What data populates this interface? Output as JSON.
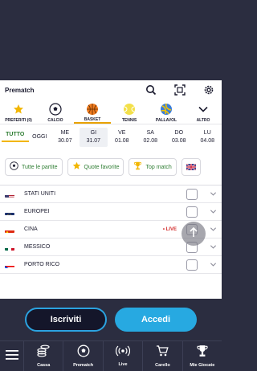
{
  "header": {
    "title": "Prematch"
  },
  "sports": [
    {
      "label": "PREFERITI (0)",
      "icon": "star-icon"
    },
    {
      "label": "CALCIO",
      "icon": "soccer-ball-icon"
    },
    {
      "label": "BASKET",
      "icon": "basketball-icon"
    },
    {
      "label": "TENNIS",
      "icon": "tennis-ball-icon"
    },
    {
      "label": "PALLAVOL",
      "icon": "volleyball-icon"
    },
    {
      "label": "ALTRO",
      "icon": "chevron-down-icon"
    }
  ],
  "dates": {
    "tutto": "TUTTO",
    "oggi": "OGGI",
    "days": [
      {
        "wd": "ME",
        "dt": "30.07"
      },
      {
        "wd": "GI",
        "dt": "31.07"
      },
      {
        "wd": "VE",
        "dt": "01.08"
      },
      {
        "wd": "SA",
        "dt": "02.08"
      },
      {
        "wd": "DO",
        "dt": "03.08"
      },
      {
        "wd": "LU",
        "dt": "04.08"
      }
    ]
  },
  "filters": [
    {
      "label": "Tutte le partite",
      "icon": "soccer-ball-icon"
    },
    {
      "label": "Quote favorite",
      "icon": "star-icon"
    },
    {
      "label": "Top match",
      "icon": "trophy-icon"
    }
  ],
  "countries": [
    {
      "name": "STATI UNITI",
      "live": ""
    },
    {
      "name": "EUROPEI",
      "live": ""
    },
    {
      "name": "CINA",
      "live": "• LIVE"
    },
    {
      "name": "MESSICO",
      "live": ""
    },
    {
      "name": "PORTO RICO",
      "live": ""
    }
  ],
  "cta": {
    "register": "Iscriviti",
    "login": "Accedi"
  },
  "nav": [
    {
      "label": "Cassa",
      "icon": "coins-icon"
    },
    {
      "label": "Prematch",
      "icon": "soccer-ball-icon"
    },
    {
      "label": "Live",
      "icon": "live-broadcast-icon"
    },
    {
      "label": "Carello",
      "icon": "cart-icon"
    },
    {
      "label": "Mie Giocate",
      "icon": "trophy-icon"
    }
  ],
  "colors": {
    "accent": "#27a9e1",
    "green": "#2e7d32",
    "live": "#d32f2f",
    "dark": "#2b2d40"
  }
}
